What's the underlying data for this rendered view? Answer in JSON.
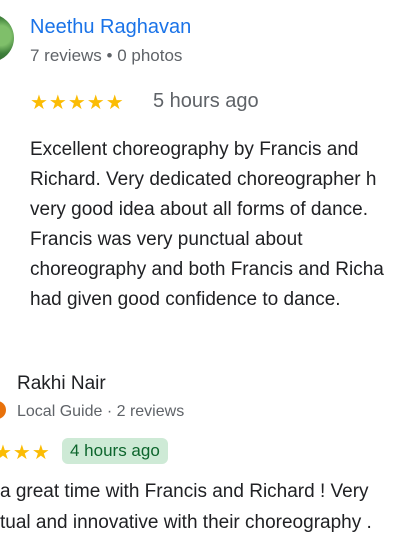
{
  "reviews": [
    {
      "reviewer_name": "Neethu Raghavan",
      "meta": "7 reviews • 0 photos",
      "stars": "★★★★★",
      "time_ago": "5 hours ago",
      "text_lines": [
        "Excellent choreography by Francis and",
        "Richard. Very dedicated choreographer h",
        "very good idea about all forms of dance.",
        "Francis was very punctual about",
        "choreography and both Francis and Richa",
        "had given good confidence to dance."
      ],
      "rating": 5
    },
    {
      "reviewer_name": "Rakhi Nair",
      "meta": "Local Guide · 2 reviews",
      "stars": "★★★",
      "time_ago": "4 hours ago",
      "text_lines": [
        "a great time with Francis and Richard ! Very",
        "tual and innovative with their choreography ."
      ],
      "colors": {
        "guide_badge": "#e8710a",
        "time_badge_bg": "#ceead6",
        "time_badge_fg": "#0d652d"
      }
    }
  ],
  "colors": {
    "name_link": "#1a73e8",
    "star": "#fbbc04",
    "secondary_text": "#5f6368"
  }
}
